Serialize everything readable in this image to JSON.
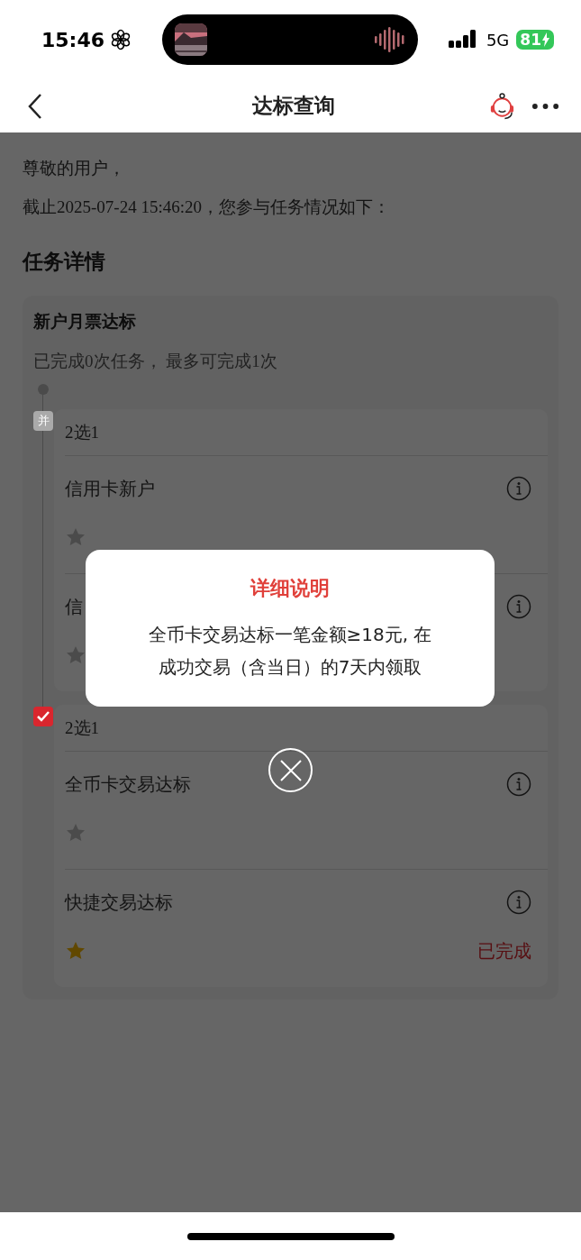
{
  "status_bar": {
    "time": "15:46",
    "network": "5G",
    "battery": "81"
  },
  "nav": {
    "title": "达标查询"
  },
  "greeting": "尊敬的用户，",
  "as_of": "截止2025-07-24 15:46:20，您参与任务情况如下：",
  "section_title": "任务详情",
  "task": {
    "title": "新户月票达标",
    "summary": "已完成0次任务， 最多可完成1次",
    "groups": [
      {
        "completed": false,
        "badge": "并",
        "header": "2选1",
        "items": [
          {
            "name": "信用卡新户",
            "achieved": false
          },
          {
            "name": "信",
            "achieved": false
          }
        ]
      },
      {
        "completed": true,
        "header": "2选1",
        "items": [
          {
            "name": "全币卡交易达标",
            "achieved": false
          },
          {
            "name": "快捷交易达标",
            "achieved": true,
            "status": "已完成"
          }
        ]
      }
    ]
  },
  "dialog": {
    "title": "详细说明",
    "lines": [
      "全币卡交易达标一笔金额≥18元, 在",
      "成功交易（含当日）的7天内领取"
    ]
  }
}
